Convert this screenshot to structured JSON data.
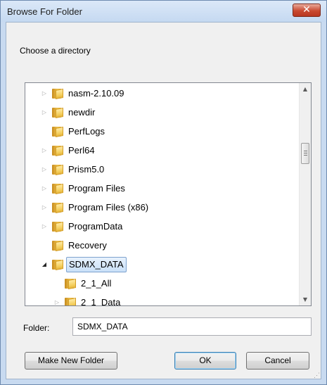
{
  "window": {
    "title": "Browse For Folder",
    "close_label": "✕"
  },
  "instruction": "Choose a directory",
  "tree": {
    "items": [
      {
        "label": "nasm-2.10.09",
        "expander": "collapsed",
        "indent": 0,
        "selected": false
      },
      {
        "label": "newdir",
        "expander": "collapsed",
        "indent": 0,
        "selected": false
      },
      {
        "label": "PerfLogs",
        "expander": "none",
        "indent": 0,
        "selected": false
      },
      {
        "label": "Perl64",
        "expander": "collapsed",
        "indent": 0,
        "selected": false
      },
      {
        "label": "Prism5.0",
        "expander": "collapsed",
        "indent": 0,
        "selected": false
      },
      {
        "label": "Program Files",
        "expander": "collapsed",
        "indent": 0,
        "selected": false
      },
      {
        "label": "Program Files (x86)",
        "expander": "collapsed",
        "indent": 0,
        "selected": false
      },
      {
        "label": "ProgramData",
        "expander": "collapsed",
        "indent": 0,
        "selected": false
      },
      {
        "label": "Recovery",
        "expander": "none",
        "indent": 0,
        "selected": false
      },
      {
        "label": "SDMX_DATA",
        "expander": "expanded",
        "indent": 0,
        "selected": true
      },
      {
        "label": "2_1_All",
        "expander": "none",
        "indent": 1,
        "selected": false
      },
      {
        "label": "2_1_Data",
        "expander": "collapsed",
        "indent": 1,
        "selected": false
      }
    ]
  },
  "folder_field": {
    "label": "Folder:",
    "value": "SDMX_DATA"
  },
  "buttons": {
    "make_new_folder": "Make New Folder",
    "ok": "OK",
    "cancel": "Cancel"
  },
  "colors": {
    "selection_border": "#7da2ce",
    "close_button": "#c94a31"
  }
}
